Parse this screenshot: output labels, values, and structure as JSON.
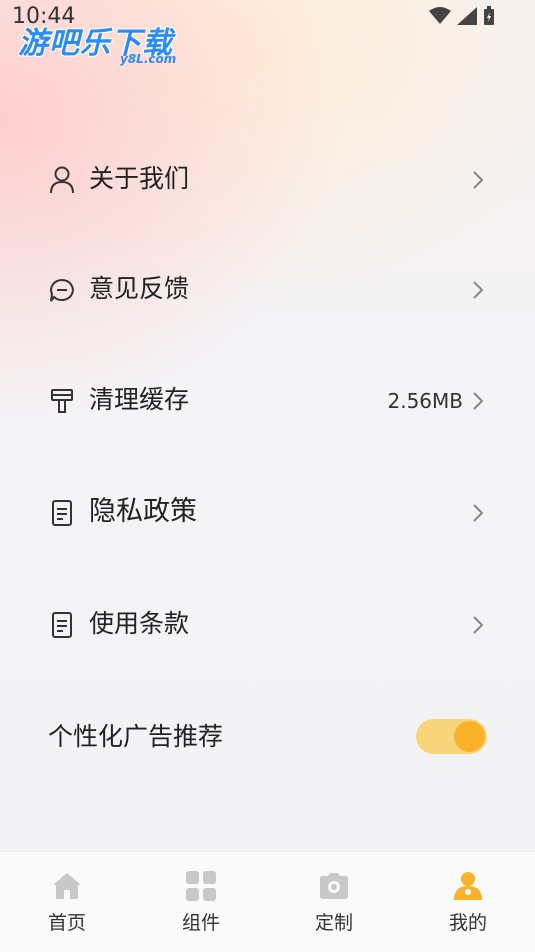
{
  "status": {
    "time": "10:44"
  },
  "logo": {
    "main": "游吧乐下载",
    "sub": "y8L.com"
  },
  "menu": [
    {
      "label": "关于我们",
      "icon": "user-icon",
      "value": ""
    },
    {
      "label": "意见反馈",
      "icon": "feedback-icon",
      "value": ""
    },
    {
      "label": "清理缓存",
      "icon": "broom-icon",
      "value": "2.56MB"
    },
    {
      "label": "隐私政策",
      "icon": "document-icon",
      "value": ""
    },
    {
      "label": "使用条款",
      "icon": "document-icon",
      "value": ""
    }
  ],
  "ad_toggle": {
    "label": "个性化广告推荐",
    "enabled": true
  },
  "tabs": [
    {
      "label": "首页",
      "icon": "home-icon",
      "active": false
    },
    {
      "label": "组件",
      "icon": "grid-icon",
      "active": false
    },
    {
      "label": "定制",
      "icon": "camera-icon",
      "active": false
    },
    {
      "label": "我的",
      "icon": "profile-icon",
      "active": true
    }
  ],
  "colors": {
    "accent": "#fbb22b",
    "toggle_track": "#f8d57a",
    "tab_inactive": "#c8c8c8",
    "logo": "#2a8cf5"
  }
}
